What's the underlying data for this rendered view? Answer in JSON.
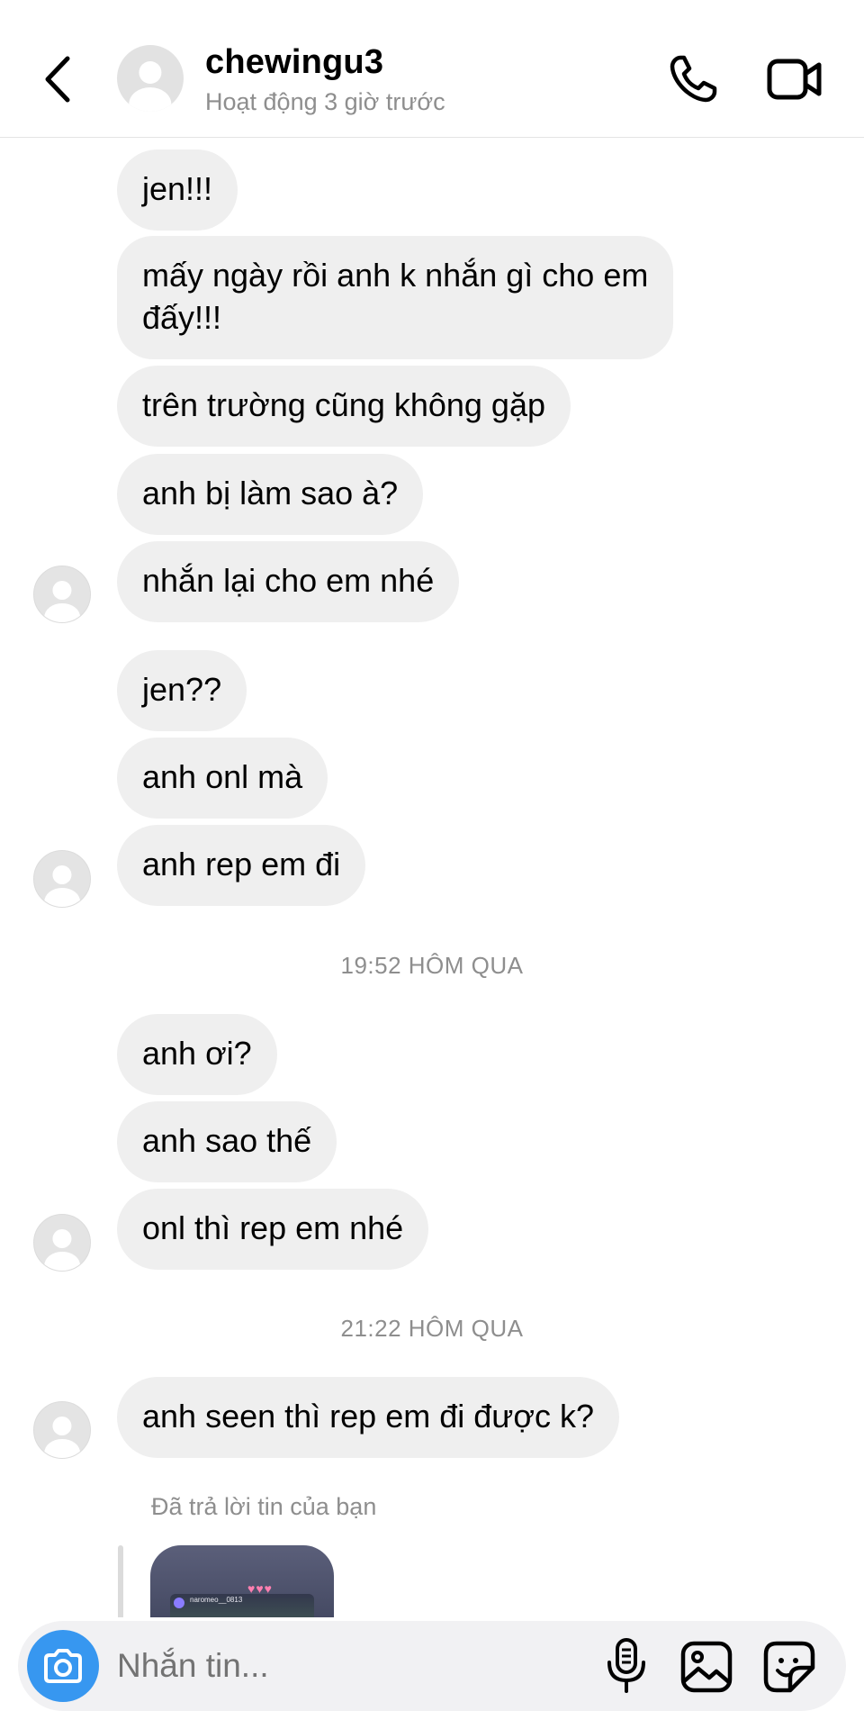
{
  "header": {
    "username": "chewingu3",
    "status": "Hoạt động 3 giờ trước"
  },
  "messages": [
    {
      "text": "jen!!!"
    },
    {
      "text": "mấy ngày rồi anh k nhắn gì cho em\nđấy!!!"
    },
    {
      "text": "trên trường cũng không gặp"
    },
    {
      "text": "anh bị làm sao à?"
    },
    {
      "text": "nhắn lại cho em nhé"
    },
    {
      "text": "jen??"
    },
    {
      "text": "anh onl mà"
    },
    {
      "text": "anh rep em đi"
    },
    {
      "text": "anh ơi?"
    },
    {
      "text": "anh sao thế"
    },
    {
      "text": "onl thì rep em nhé"
    },
    {
      "text": "anh seen thì rep em đi được k?"
    }
  ],
  "timestamps": [
    "19:52 HÔM QUA",
    "21:22 HÔM QUA"
  ],
  "reply": {
    "note": "Đã trả lời tin của bạn",
    "story_username": "naromeo__0813"
  },
  "composer": {
    "placeholder": "Nhắn tin..."
  },
  "icons": {
    "back": "chevron-left-icon",
    "call": "phone-icon",
    "video": "video-camera-icon",
    "camera": "camera-icon",
    "mic": "microphone-icon",
    "gallery": "image-icon",
    "sticker": "sticker-icon"
  },
  "colors": {
    "accent": "#3797f0",
    "bubble": "#efefef",
    "muted": "#8e8e8e"
  }
}
